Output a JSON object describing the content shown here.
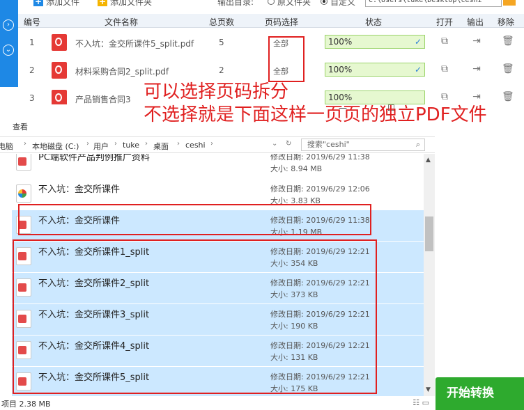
{
  "toolbar": {
    "add_file": "添加文件",
    "add_folder": "添加文件夹",
    "output_dir_label": "输出目录:",
    "option_source_folder": "原文件夹",
    "option_custom": "自定义",
    "output_path": "C:\\Users\\tuke\\Desktop\\ceshi"
  },
  "table": {
    "headers": {
      "number": "编号",
      "file_name": "文件名称",
      "total_pages": "总页数",
      "page_select": "页码选择",
      "status": "状态",
      "open": "打开",
      "output": "输出",
      "remove": "移除"
    },
    "rows": [
      {
        "number": "1",
        "file_name": "不入坑：金交所课件5_split.pdf",
        "pages": "5",
        "range": "全部",
        "status": "100%"
      },
      {
        "number": "2",
        "file_name": "材料采购合同2_split.pdf",
        "pages": "2",
        "range": "全部",
        "status": "100%"
      },
      {
        "number": "3",
        "file_name": "产品销售合同3",
        "pages": "",
        "range": "",
        "status": "100%"
      }
    ]
  },
  "annotation": {
    "line1": "可以选择页码拆分",
    "line2": "不选择就是下面这样一页页的独立PDF文件"
  },
  "explorer": {
    "ribbon_view": "查看",
    "window_min": "—",
    "window_max": "☐",
    "breadcrumb": [
      "此电脑",
      "本地磁盘 (C:)",
      "用户",
      "tuke",
      "桌面",
      "ceshi"
    ],
    "search_placeholder": "搜索\"ceshi\"",
    "files": [
      {
        "name": "PC端软件产品判例推广资料",
        "modified": "修改日期: 2019/6/29 11:38",
        "size": "大小: 8.94 MB",
        "selected": false
      },
      {
        "name": "不入坑：金交所课件",
        "modified": "修改日期: 2019/6/29 12:06",
        "size": "大小: 3.83 KB",
        "selected": false
      },
      {
        "name": "不入坑：金交所课件",
        "modified": "修改日期: 2019/6/29 11:38",
        "size": "大小: 1.19 MB",
        "selected": true
      },
      {
        "name": "不入坑：金交所课件1_split",
        "modified": "修改日期: 2019/6/29 12:21",
        "size": "大小: 354 KB",
        "selected": true
      },
      {
        "name": "不入坑：金交所课件2_split",
        "modified": "修改日期: 2019/6/29 12:21",
        "size": "大小: 373 KB",
        "selected": true
      },
      {
        "name": "不入坑：金交所课件3_split",
        "modified": "修改日期: 2019/6/29 12:21",
        "size": "大小: 190 KB",
        "selected": true
      },
      {
        "name": "不入坑：金交所课件4_split",
        "modified": "修改日期: 2019/6/29 12:21",
        "size": "大小: 131 KB",
        "selected": true
      },
      {
        "name": "不入坑：金交所课件5_split",
        "modified": "修改日期: 2019/6/29 12:21",
        "size": "大小: 175 KB",
        "selected": true
      }
    ],
    "status_text": "项目 2.38 MB"
  },
  "start_button": "开始转换",
  "colors": {
    "brand_blue": "#1e88e5",
    "highlight_red": "#e02020",
    "progress_green": "#e6f8d0",
    "start_green": "#2eaa2e",
    "selection_blue": "#cce8ff"
  }
}
